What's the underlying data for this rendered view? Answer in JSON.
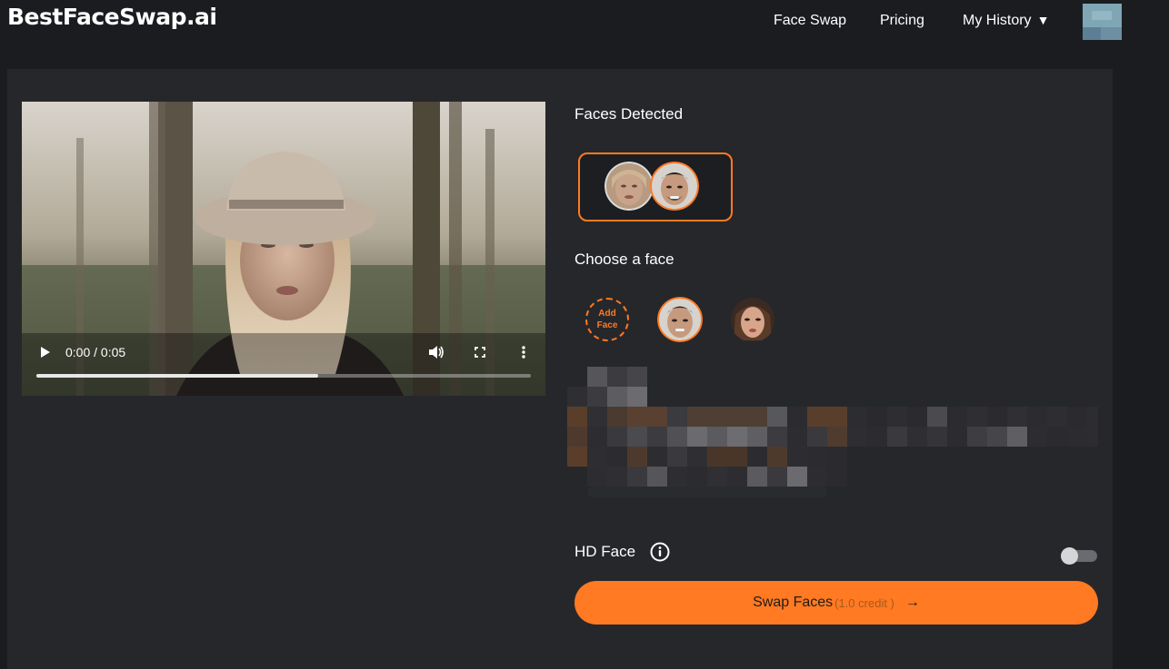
{
  "header": {
    "logo": "BestFaceSwap.ai",
    "nav": [
      {
        "label": "Face Swap"
      },
      {
        "label": "Pricing"
      },
      {
        "label": "My History",
        "caret": "▼"
      }
    ]
  },
  "video": {
    "time": "0:00 / 0:05",
    "progress": 0.57,
    "icons": [
      "play-icon",
      "volume-icon",
      "fullscreen-icon",
      "more-options-icon"
    ]
  },
  "faces_detected": {
    "title": "Faces Detected"
  },
  "choose_face": {
    "title": "Choose a face",
    "add_label_1": "Add",
    "add_label_2": "Face"
  },
  "hd": {
    "label": "HD Face",
    "enabled": false
  },
  "swap": {
    "label": "Swap Faces",
    "credit": "(1.0 credit )",
    "arrow": "→"
  },
  "colors": {
    "accent": "#ff7a22",
    "background": "#1b1c20",
    "panel": "#26272b"
  }
}
